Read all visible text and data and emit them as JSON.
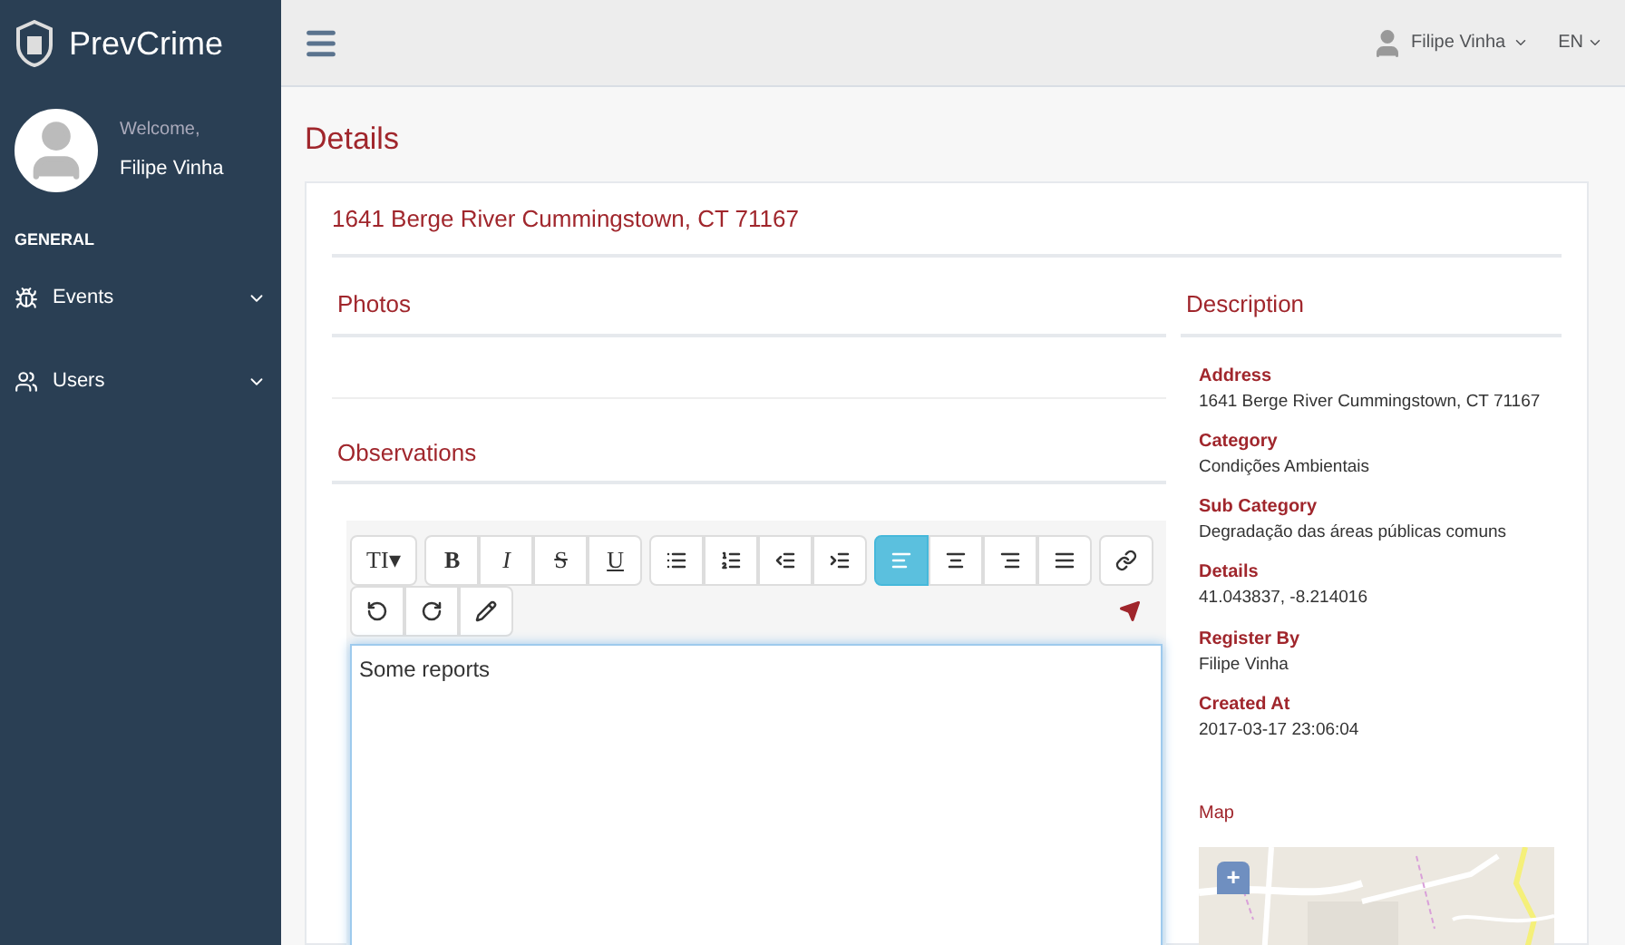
{
  "brand": "PrevCrime",
  "profile": {
    "welcome": "Welcome,",
    "name": "Filipe Vinha"
  },
  "sidebar": {
    "section": "GENERAL",
    "items": [
      {
        "label": "Events",
        "expanded": false
      },
      {
        "label": "Users",
        "expanded": false
      }
    ]
  },
  "topbar": {
    "user": "Filipe Vinha",
    "language": "EN"
  },
  "page_title": "Details",
  "address_title": "1641 Berge River Cummingstown, CT 71167",
  "photos_title": "Photos",
  "observations_title": "Observations",
  "toolbar": [
    [
      {
        "kind": "text",
        "label": "TI▾",
        "selected": false
      }
    ],
    [
      {
        "kind": "text",
        "label": "B",
        "selected": false
      },
      {
        "kind": "text",
        "label": "I",
        "selected": false
      },
      {
        "kind": "text",
        "label": "S",
        "selected": false
      },
      {
        "kind": "text",
        "label": "U",
        "selected": false
      }
    ],
    [
      {
        "kind": "icon",
        "selected": false
      },
      {
        "kind": "icon",
        "selected": false
      },
      {
        "kind": "icon",
        "selected": false
      },
      {
        "kind": "icon",
        "selected": false
      }
    ],
    [
      {
        "kind": "icon",
        "selected": true
      },
      {
        "kind": "icon",
        "selected": false
      },
      {
        "kind": "icon",
        "selected": false
      },
      {
        "kind": "icon",
        "selected": false
      }
    ],
    [
      {
        "kind": "icon",
        "selected": false
      }
    ],
    [
      {
        "kind": "icon",
        "selected": false
      },
      {
        "kind": "icon",
        "selected": false
      },
      {
        "kind": "icon",
        "selected": false
      }
    ]
  ],
  "editor_text": "Some reports",
  "description": {
    "title": "Description",
    "fields": [
      {
        "label": "Address",
        "value": "1641 Berge River Cummingstown, CT 71167"
      },
      {
        "label": "Category",
        "value": "Condições Ambientais"
      },
      {
        "label": "Sub Category",
        "value": "Degradação das áreas públicas comuns"
      },
      {
        "label": "Details",
        "value": "41.043837, -8.214016"
      },
      {
        "label": "Register By",
        "value": "Filipe Vinha"
      },
      {
        "label": "Created At",
        "value": "2017-03-17 23:06:04"
      }
    ],
    "map_title": "Map",
    "map_zoom_in": "+"
  }
}
